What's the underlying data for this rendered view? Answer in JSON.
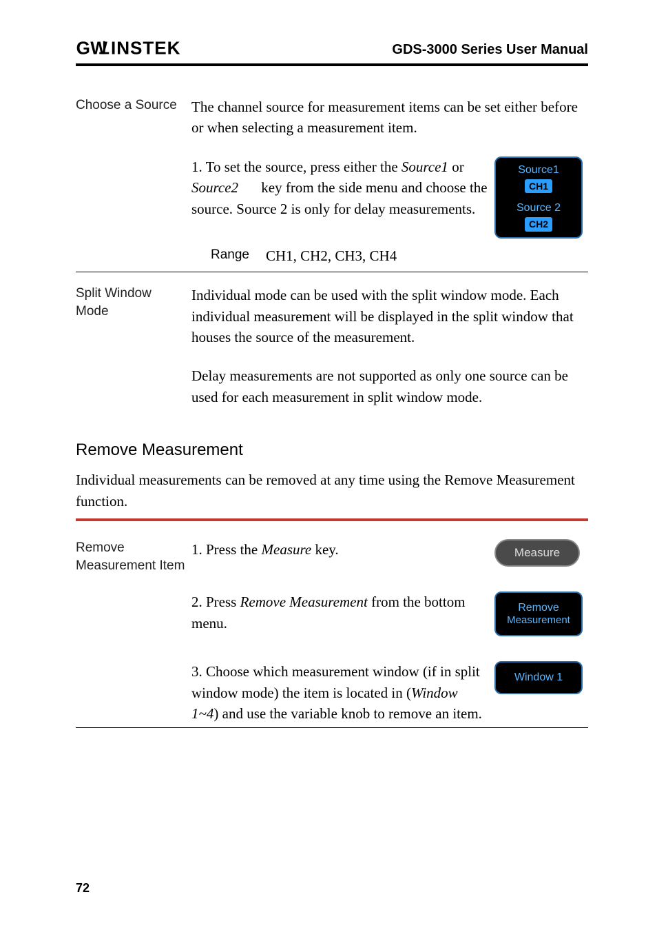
{
  "header": {
    "brand": "GWINSTEK",
    "title": "GDS-3000 Series User Manual"
  },
  "chooseSource": {
    "label": "Choose a Source",
    "intro": "The channel source for measurement items can be set either before or when selecting a measurement item.",
    "step1_a": "1.  To set the source, press either the ",
    "step1_src1": "Source1",
    "step1_or": " or ",
    "step1_src2": "Source2",
    "step1_b": " key from the side menu and choose the source. Source 2 is only for delay measurements.",
    "softkey": {
      "top_label": "Source1",
      "top_tag": "CH1",
      "bot_label": "Source 2",
      "bot_tag": "CH2"
    },
    "range_label": "Range",
    "range_value": "CH1, CH2, CH3, CH4"
  },
  "splitWindow": {
    "label": "Split Window Mode",
    "p1": "Individual mode can be used with the split window mode. Each individual measurement will be displayed in the split window that houses the source of the measurement.",
    "p2": "Delay measurements are not supported as only one source can be used for each measurement in split window mode."
  },
  "removeMeasurement": {
    "heading": "Remove Measurement",
    "intro": "Individual measurements can be removed at any time using the Remove Measurement function.",
    "item_label": "Remove Measurement Item",
    "step1_a": "1.  Press the ",
    "step1_key": "Measure",
    "step1_b": " key.",
    "measure_btn": "Measure",
    "step2_a": "2.  Press ",
    "step2_key": "Remove Measurement",
    "step2_b": " from the bottom menu.",
    "remove_sk_line1": "Remove",
    "remove_sk_line2": "Measurement",
    "step3_a": "3.  Choose which measurement window (if in split window mode) the item is located in (",
    "step3_key": "Window 1~4",
    "step3_b": ") and use the variable knob to remove an item.",
    "window_sk": "Window 1"
  },
  "page_number": "72"
}
